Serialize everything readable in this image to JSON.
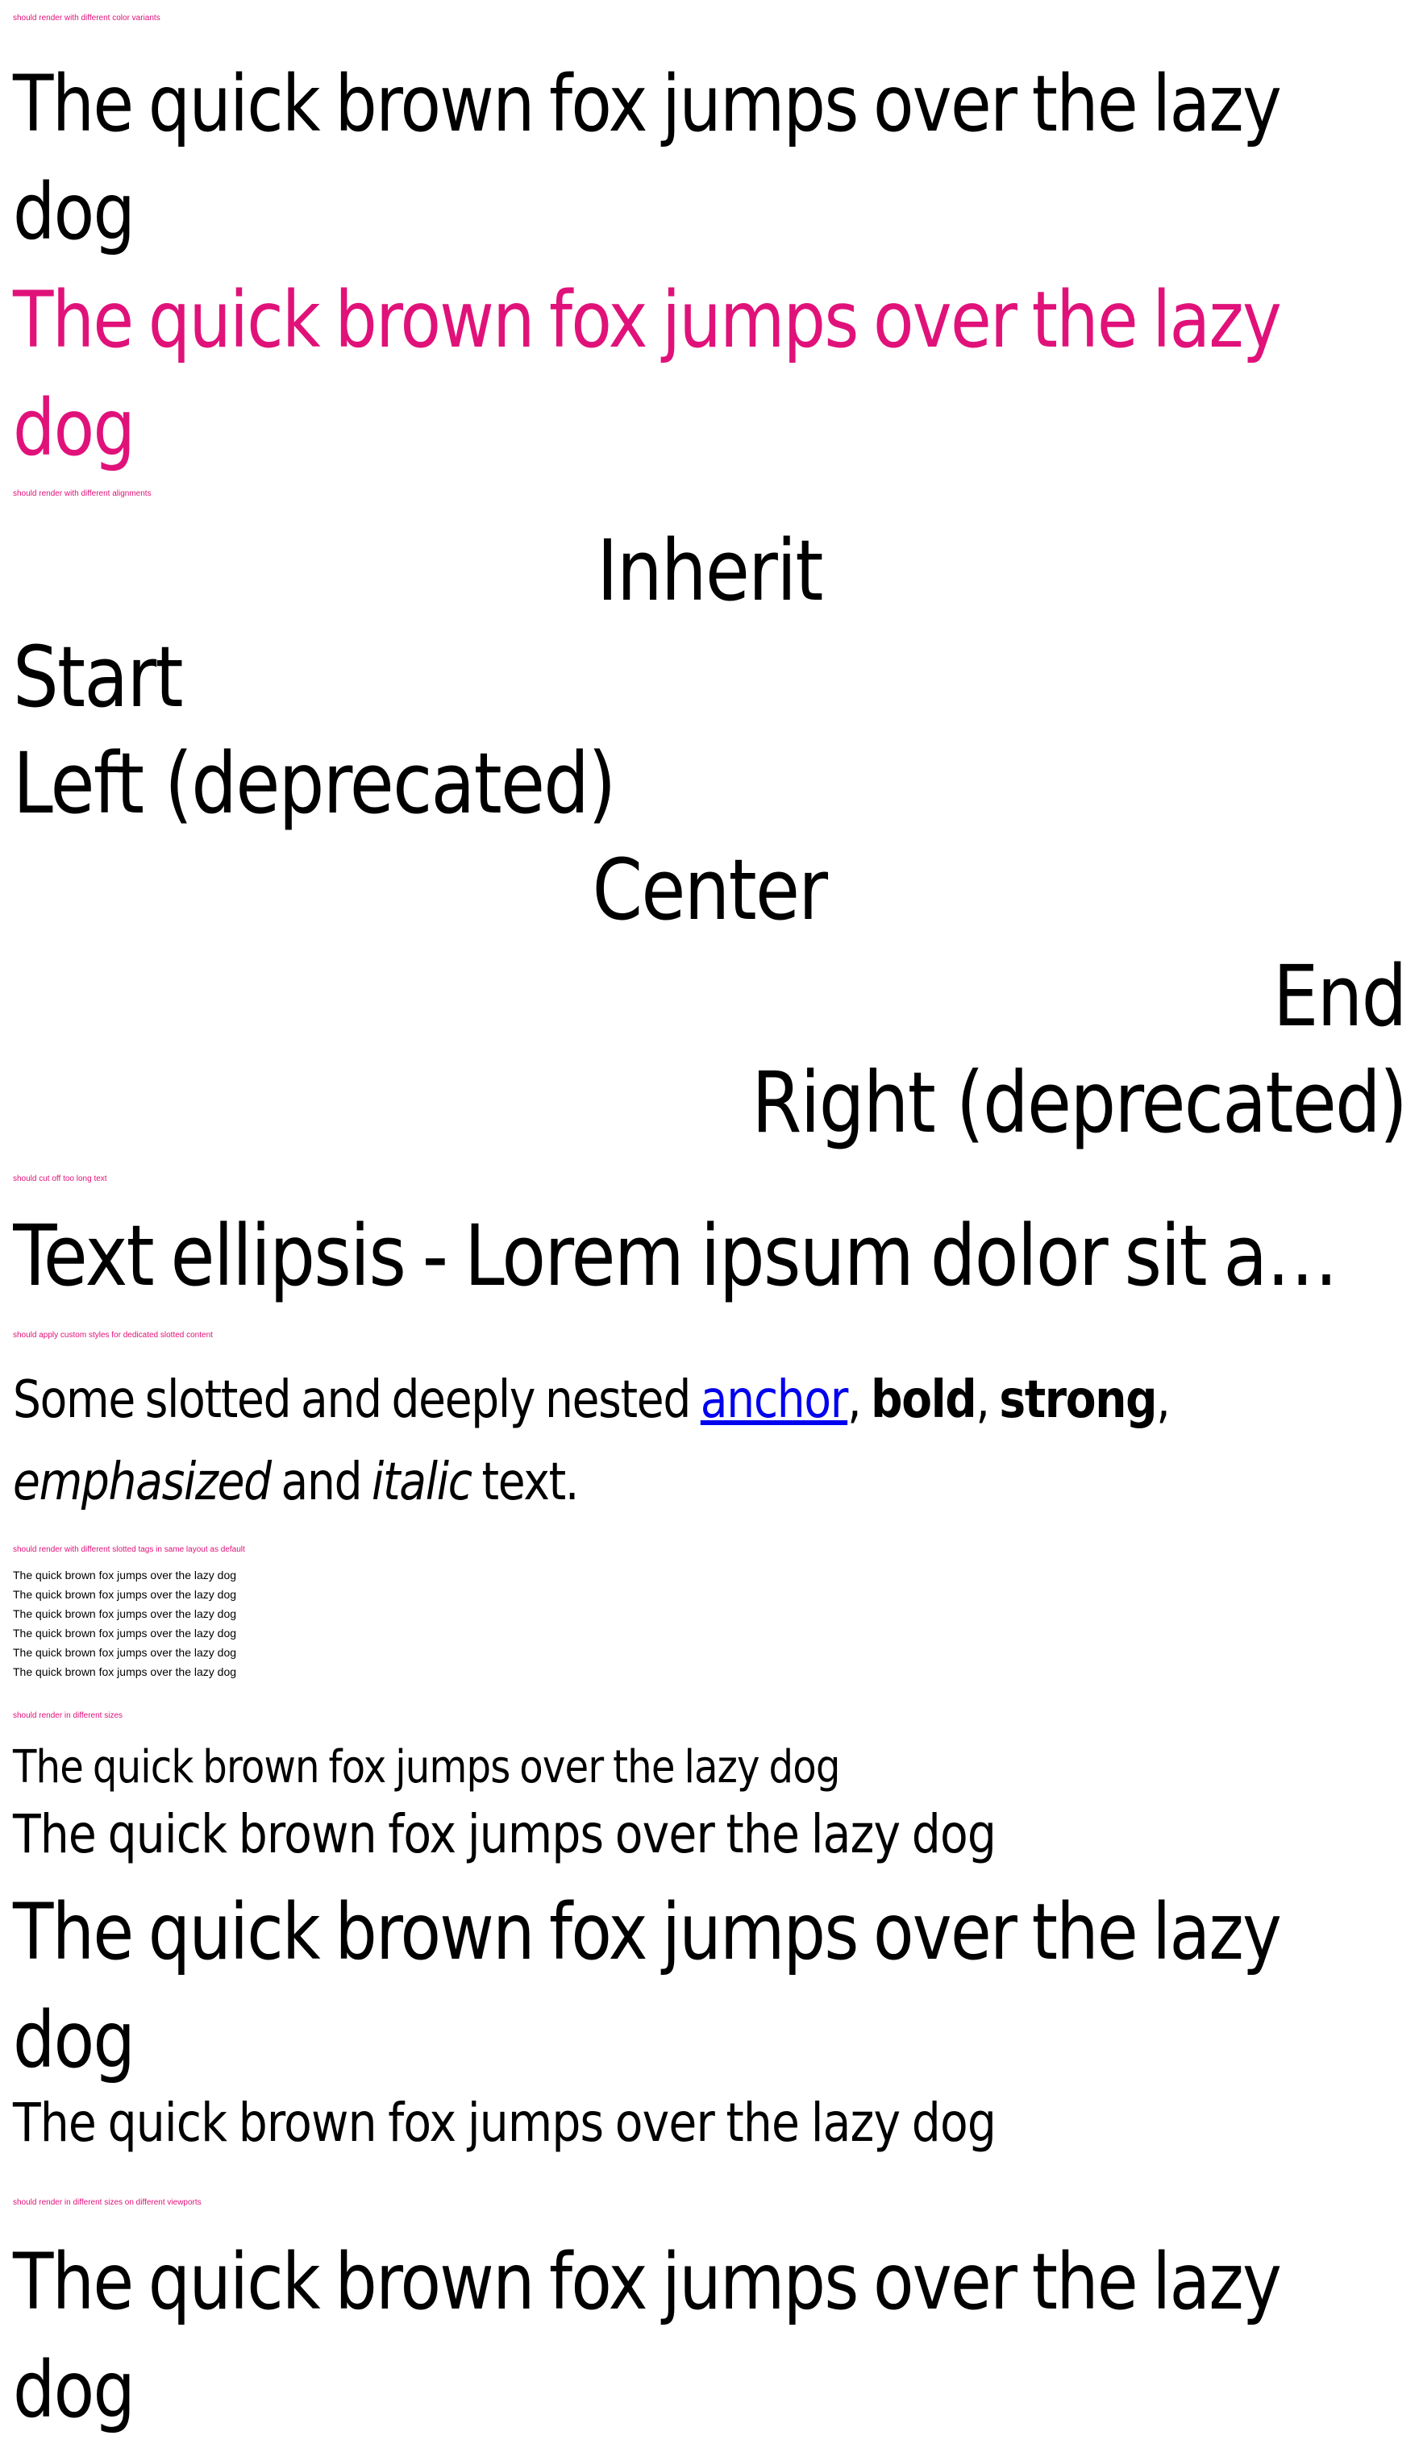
{
  "colors": {
    "caption": "#e0127a",
    "default_text": "#000000",
    "variant_text": "#e0127a",
    "anchor": "#0000ee"
  },
  "sections": {
    "color_variants": {
      "caption": "should render with different color variants",
      "default": "The quick brown fox jumps over the lazy dog",
      "variant": "The quick brown fox jumps over the lazy dog"
    },
    "alignments": {
      "caption": "should render with different alignments",
      "inherit": "Inherit",
      "start": "Start",
      "left": "Left (deprecated)",
      "center": "Center",
      "end": "End",
      "right": "Right (deprecated)"
    },
    "ellipsis": {
      "caption": "should cut off too long text",
      "text": "Text ellipsis - Lorem ipsum dolor sit amet, consetetur sadipscing elitr, sed diam nonumy eirmod tempor invidunt ut labore et dolore magna aliquyam erat"
    },
    "slotted": {
      "caption": "should apply custom styles for dedicated slotted content",
      "prefix": "Some slotted and deeply nested ",
      "anchor": "anchor",
      "comma1": ", ",
      "bold": "bold",
      "comma2": ", ",
      "strong": "strong",
      "comma3": ", ",
      "emphasized": "emphasized",
      "and": " and ",
      "italic": "italic",
      "suffix": " text."
    },
    "slotted_tags": {
      "caption": "should render with different slotted tags in same layout as default",
      "lines": [
        "The quick brown fox jumps over the lazy dog",
        "The quick brown fox jumps over the lazy dog",
        "The quick brown fox jumps over the lazy dog",
        "The quick brown fox jumps over the lazy dog",
        "The quick brown fox jumps over the lazy dog",
        "The quick brown fox jumps over the lazy dog"
      ]
    },
    "sizes": {
      "caption": "should render in different sizes",
      "small": "The quick brown fox jumps over the lazy dog",
      "medium": "The quick brown fox jumps over the lazy dog",
      "large": "The quick brown fox jumps over the lazy dog",
      "inherit": "The quick brown fox jumps over the lazy dog"
    },
    "viewports": {
      "caption": "should render in different sizes on different viewports",
      "text": "The quick brown fox jumps over the lazy dog"
    }
  }
}
